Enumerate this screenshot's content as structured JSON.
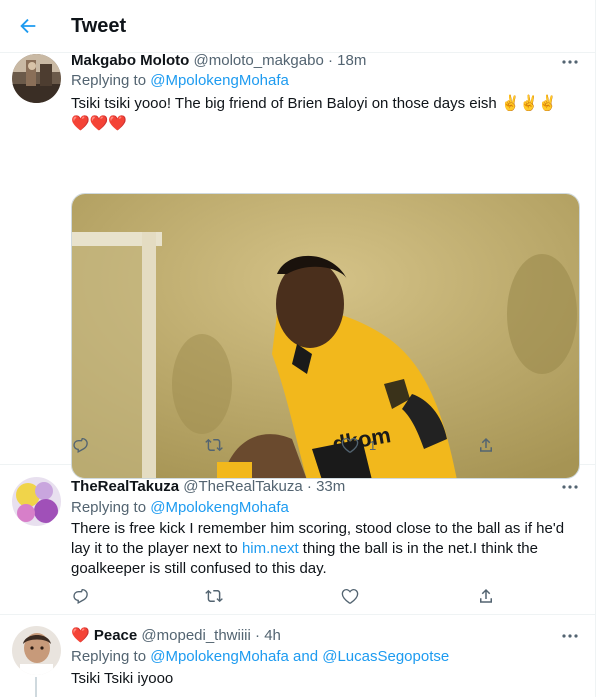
{
  "header": {
    "title": "Tweet"
  },
  "tweets": [
    {
      "name": "Makgabo Moloto",
      "handle": "@moloto_makgabo",
      "dot": "·",
      "time": "18m",
      "replying_prefix": "Replying to",
      "replying_to": "@MpolokengMohafa",
      "text_line1": "Tsiki tsiki yooo! The big friend of Brien Baloyi  on those days  eish ✌️✌️✌️",
      "text_line2": "❤️❤️❤️",
      "likes": "1"
    },
    {
      "name": "TheRealTakuza",
      "handle": "@TheRealTakuza",
      "dot": "·",
      "time": "33m",
      "replying_prefix": "Replying to",
      "replying_to": "@MpolokengMohafa",
      "text_a": "There is free kick I remember him scoring, stood close to the ball as if he'd lay it to the  player next to ",
      "text_link": "him.next",
      "text_b": " thing the ball is in the net.I think the goalkeeper is still confused to this day."
    },
    {
      "name_emoji": "❤️",
      "name": "Peace",
      "handle": "@mopedi_thwiiii",
      "dot": "·",
      "time": "4h",
      "replying_prefix": "Replying to",
      "replying_to": "@MpolokengMohafa",
      "replying_and": "and",
      "replying_to2": "@LucasSegopotse",
      "text": "Tsiki Tsiki iyooo"
    }
  ],
  "icons": {
    "back": "arrow-left-icon",
    "more": "more-horizontal-icon",
    "reply": "reply-icon",
    "retweet": "retweet-icon",
    "like": "heart-icon",
    "share": "share-icon"
  },
  "colors": {
    "accent": "#1d9bf0",
    "text": "#0f1419",
    "secondary": "#536471",
    "border": "#eff3f4"
  }
}
